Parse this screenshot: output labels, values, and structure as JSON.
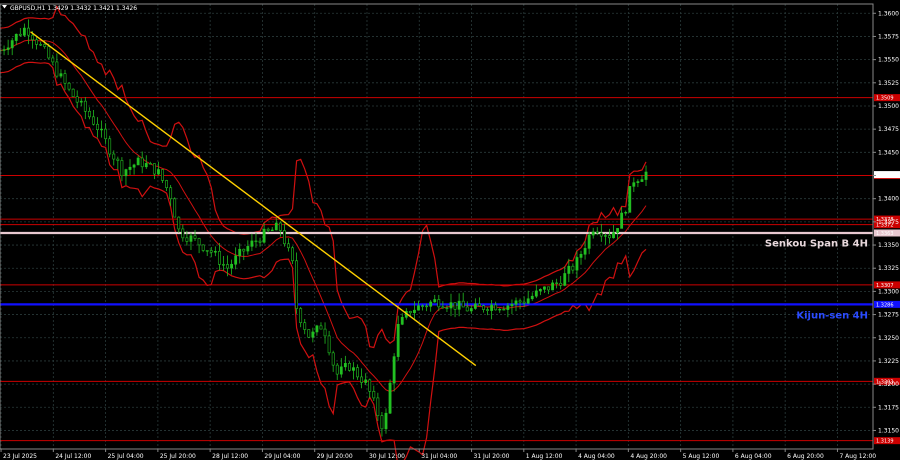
{
  "header": {
    "symbol_line": "GBPUSD,H1  1.3429 1.3432 1.3421 1.3426"
  },
  "chart_data": {
    "type": "candlestick",
    "symbol": "GBPUSD",
    "timeframe": "H1",
    "ohlc_last": {
      "open": 1.3429,
      "high": 1.3432,
      "low": 1.3421,
      "close": 1.3426
    },
    "ylim": [
      1.313,
      1.361
    ],
    "y_ticks": [
      "1.3600",
      "1.3575",
      "1.3550",
      "1.3525",
      "1.3500",
      "1.3475",
      "1.3450",
      "1.3425",
      "1.3400",
      "1.3375",
      "1.3350",
      "1.3325",
      "1.3300",
      "1.3275",
      "1.3250",
      "1.3225",
      "1.3200",
      "1.3175",
      "1.3150"
    ],
    "x_ticks": [
      "23 Jul 2025",
      "24 Jul 12:00",
      "25 Jul 04:00",
      "25 Jul 20:00",
      "28 Jul 12:00",
      "29 Jul 04:00",
      "29 Jul 20:00",
      "30 Jul 12:00",
      "31 Jul 04:00",
      "31 Jul 20:00",
      "1 Aug 12:00",
      "4 Aug 04:00",
      "4 Aug 20:00",
      "5 Aug 12:00",
      "6 Aug 04:00",
      "6 Aug 20:00",
      "7 Aug 12:00"
    ],
    "current_price_label": "1.3426",
    "levels": [
      {
        "name": "resistance",
        "price": 1.3509,
        "label": "1.3509",
        "color": "#cc0000"
      },
      {
        "name": "resistance",
        "price": 1.3425,
        "label": "1.3425",
        "color": "#cc0000"
      },
      {
        "name": "resistance",
        "price": 1.3378,
        "label": "1.3378",
        "color": "#cc0000"
      },
      {
        "name": "resistance",
        "price": 1.3372,
        "label": "1.3372",
        "color": "#cc0000"
      },
      {
        "name": "senkou-span-b",
        "price": 1.3363,
        "label": "1.3363",
        "color": "#e8c8d0"
      },
      {
        "name": "support",
        "price": 1.3307,
        "label": "1.3307",
        "color": "#cc0000"
      },
      {
        "name": "kijun-sen",
        "price": 1.3286,
        "label": "1.3286",
        "color": "#1010ff"
      },
      {
        "name": "support",
        "price": 1.3203,
        "label": "1.3203",
        "color": "#cc0000"
      },
      {
        "name": "support",
        "price": 1.3139,
        "label": "1.3139",
        "color": "#cc0000"
      }
    ],
    "annotations": [
      {
        "text": "Senkou Span B 4H",
        "price": 1.3353,
        "color": "#e8d8dc"
      },
      {
        "text": "Kijun-sen 4H",
        "price": 1.3275,
        "color": "#2a4bff"
      }
    ],
    "trendline": {
      "start": {
        "x_frac": 0.035,
        "price": 1.358
      },
      "end": {
        "x_frac": 0.545,
        "price": 1.322
      },
      "color": "#ffd000"
    },
    "anchors": [
      [
        0.0,
        1.356
      ],
      [
        0.03,
        1.3585
      ],
      [
        0.05,
        1.356
      ],
      [
        0.08,
        1.3515
      ],
      [
        0.11,
        1.348
      ],
      [
        0.14,
        1.343
      ],
      [
        0.16,
        1.344
      ],
      [
        0.18,
        1.343
      ],
      [
        0.195,
        1.3405
      ],
      [
        0.205,
        1.3365
      ],
      [
        0.24,
        1.3345
      ],
      [
        0.26,
        1.3325
      ],
      [
        0.28,
        1.3345
      ],
      [
        0.3,
        1.336
      ],
      [
        0.32,
        1.337
      ],
      [
        0.335,
        1.333
      ],
      [
        0.34,
        1.328
      ],
      [
        0.355,
        1.325
      ],
      [
        0.37,
        1.3265
      ],
      [
        0.385,
        1.321
      ],
      [
        0.4,
        1.322
      ],
      [
        0.42,
        1.32
      ],
      [
        0.44,
        1.315
      ],
      [
        0.455,
        1.326
      ],
      [
        0.47,
        1.328
      ],
      [
        0.5,
        1.329
      ],
      [
        0.52,
        1.3285
      ],
      [
        0.54,
        1.328
      ],
      [
        0.56,
        1.3285
      ],
      [
        0.58,
        1.3285
      ],
      [
        0.6,
        1.329
      ],
      [
        0.62,
        1.33
      ],
      [
        0.64,
        1.331
      ],
      [
        0.66,
        1.333
      ],
      [
        0.68,
        1.337
      ],
      [
        0.7,
        1.336
      ],
      [
        0.715,
        1.3385
      ],
      [
        0.725,
        1.342
      ],
      [
        0.74,
        1.3428
      ]
    ],
    "bollinger_upper_offset": 0.004,
    "bollinger_lower_offset": 0.004,
    "colors": {
      "background": "#000000",
      "bull_candle": "#22c022",
      "bear_candle": "#000000",
      "candle_outline": "#22c022",
      "grid": "#2a3a3a",
      "axis_text": "#ffffff",
      "bands": "#d01010",
      "trendline": "#ffd000"
    },
    "grid": true
  }
}
